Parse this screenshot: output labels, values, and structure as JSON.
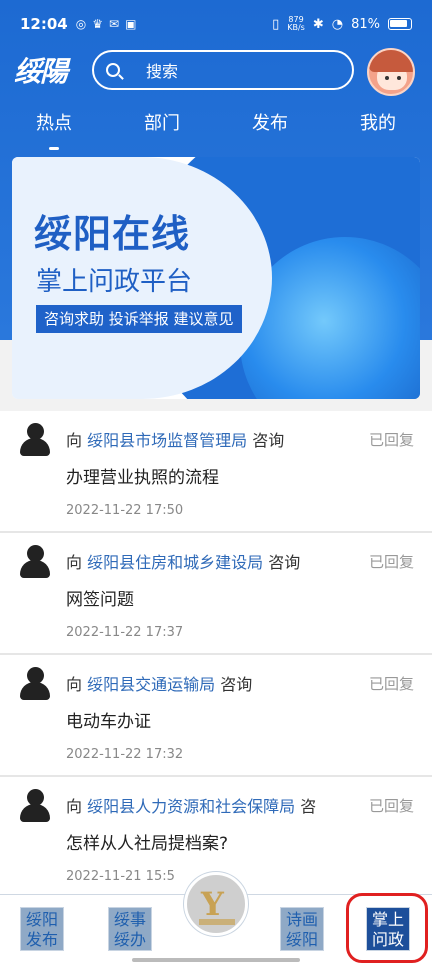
{
  "status_bar": {
    "time": "12:04",
    "battery": "81%",
    "net_speed_value": "879",
    "net_speed_unit": "KB/s"
  },
  "header": {
    "logo_text": "绥陽",
    "search_placeholder": "搜索"
  },
  "tabs": [
    {
      "label": "热点",
      "active": true
    },
    {
      "label": "部门",
      "active": false
    },
    {
      "label": "发布",
      "active": false
    },
    {
      "label": "我的",
      "active": false
    }
  ],
  "banner": {
    "title": "绥阳在线",
    "subtitle": "掌上问政平台",
    "tagline": "咨询求助  投诉举报  建议意见"
  },
  "list": [
    {
      "prefix": "向",
      "dept": "绥阳县市场监督管理局",
      "suffix": "咨询",
      "status": "已回复",
      "title": "办理营业执照的流程",
      "time": "2022-11-22 17:50"
    },
    {
      "prefix": "向",
      "dept": "绥阳县住房和城乡建设局",
      "suffix": "咨询",
      "status": "已回复",
      "title": "网签问题",
      "time": "2022-11-22 17:37"
    },
    {
      "prefix": "向",
      "dept": "绥阳县交通运输局",
      "suffix": "咨询",
      "status": "已回复",
      "title": "电动车办证",
      "time": "2022-11-22 17:32"
    },
    {
      "prefix": "向",
      "dept": "绥阳县人力资源和社会保障局",
      "suffix": "咨",
      "status": "已回复",
      "title": "怎样从人社局提档案?",
      "time": "2022-11-21 15:5"
    }
  ],
  "bottom_nav": [
    {
      "line1": "绥阳",
      "line2": "发布"
    },
    {
      "line1": "绥事",
      "line2": "绥办"
    },
    {
      "line1": "诗画",
      "line2": "绥阳"
    },
    {
      "line1": "掌上",
      "line2": "问政"
    }
  ]
}
